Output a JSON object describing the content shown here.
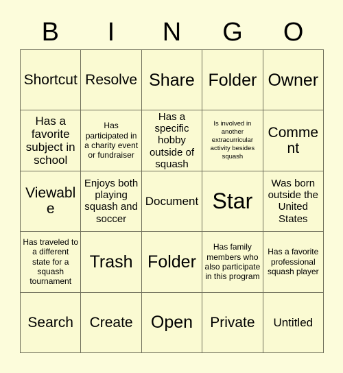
{
  "card": {
    "title_letters": [
      "B",
      "I",
      "N",
      "G",
      "O"
    ],
    "colors": {
      "background": "#FCFCDB",
      "cell_background": "#FAFAD2",
      "grid_line": "#6E6E5A",
      "text": "#000000"
    },
    "grid": {
      "columns": 5,
      "rows": 5,
      "cells": [
        [
          {
            "text": "Shortcut",
            "size": "lg"
          },
          {
            "text": "Resolve",
            "size": "lg"
          },
          {
            "text": "Share",
            "size": "xl"
          },
          {
            "text": "Folder",
            "size": "xl"
          },
          {
            "text": "Owner",
            "size": "xl"
          }
        ],
        [
          {
            "text": "Has a favorite subject in school",
            "size": "md"
          },
          {
            "text": "Has participated in a charity event or fundraiser",
            "size": "xs"
          },
          {
            "text": "Has a specific hobby outside of squash",
            "size": "sm"
          },
          {
            "text": "Is involved in another extracurricular activity besides squash",
            "size": "xxs"
          },
          {
            "text": "Comment",
            "size": "lg"
          }
        ],
        [
          {
            "text": "Viewable",
            "size": "lg"
          },
          {
            "text": "Enjoys both playing squash and soccer",
            "size": "sm"
          },
          {
            "text": "Document",
            "size": "md"
          },
          {
            "text": "Star",
            "size": "xxl"
          },
          {
            "text": "Was born outside the United States",
            "size": "sm"
          }
        ],
        [
          {
            "text": "Has traveled to a different state for a squash tournament",
            "size": "xs"
          },
          {
            "text": "Trash",
            "size": "xl"
          },
          {
            "text": "Folder",
            "size": "xl"
          },
          {
            "text": "Has family members who also participate in this program",
            "size": "xs"
          },
          {
            "text": "Has a favorite professional squash player",
            "size": "xs"
          }
        ],
        [
          {
            "text": "Search",
            "size": "lg"
          },
          {
            "text": "Create",
            "size": "lg"
          },
          {
            "text": "Open",
            "size": "xl"
          },
          {
            "text": "Private",
            "size": "lg"
          },
          {
            "text": "Untitled",
            "size": "md"
          }
        ]
      ]
    }
  }
}
